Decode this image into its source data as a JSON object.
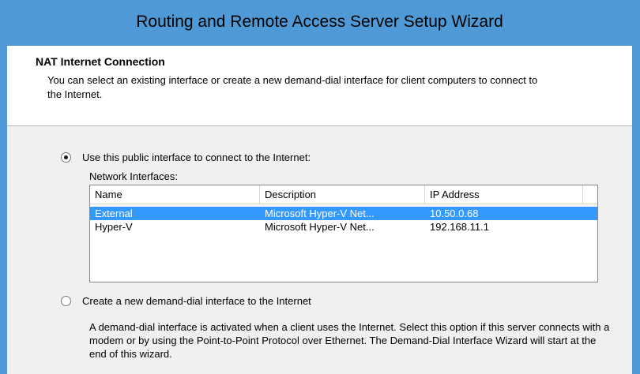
{
  "window": {
    "title": "Routing and Remote Access Server Setup Wizard",
    "accent_color": "#4f9ad6"
  },
  "header": {
    "title": "NAT Internet Connection",
    "description": "You can select an existing interface or create a new demand-dial interface for client computers to connect to the Internet."
  },
  "options": {
    "public_interface": {
      "label": "Use this public interface to connect to the Internet:",
      "checked": true
    },
    "demand_dial": {
      "label": "Create a new demand-dial interface to the Internet",
      "checked": false,
      "description": "A demand-dial interface is activated when a client uses the Internet. Select this option if this server connects with a modem or by using the Point-to-Point Protocol over Ethernet. The Demand-Dial Interface Wizard will start at the end of this wizard."
    }
  },
  "interfaces": {
    "label": "Network Interfaces:",
    "columns": [
      "Name",
      "Description",
      "IP Address"
    ],
    "rows": [
      {
        "name": "External",
        "description": "Microsoft Hyper-V Net...",
        "ip": "10.50.0.68",
        "selected": true
      },
      {
        "name": "Hyper-V",
        "description": "Microsoft Hyper-V Net...",
        "ip": "192.168.11.1",
        "selected": false
      }
    ],
    "selection_color": "#3399ff"
  }
}
